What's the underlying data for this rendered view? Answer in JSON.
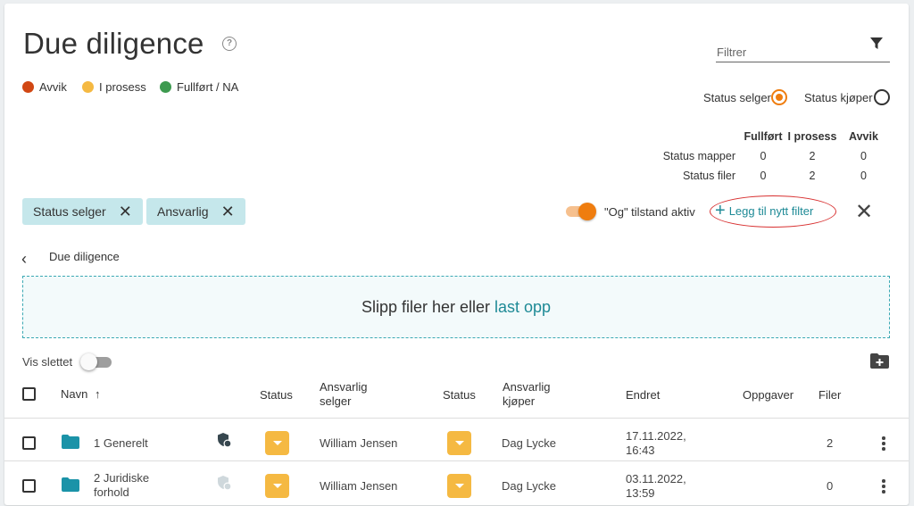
{
  "header": {
    "title": "Due diligence",
    "help_icon": "help-circle-icon",
    "filter_placeholder": "Filtrer"
  },
  "legend": [
    {
      "label": "Avvik",
      "color": "#d14713"
    },
    {
      "label": "I prosess",
      "color": "#f5b942"
    },
    {
      "label": "Fullført / NA",
      "color": "#3d9a4f"
    }
  ],
  "status_toggle": {
    "seller_label": "Status selger",
    "buyer_label": "Status kjøper",
    "selected": "Status selger"
  },
  "stats": {
    "columns": [
      "Fullført",
      "I prosess",
      "Avvik"
    ],
    "rows": [
      {
        "label": "Status mapper",
        "values": [
          "0",
          "2",
          "0"
        ]
      },
      {
        "label": "Status filer",
        "values": [
          "0",
          "2",
          "0"
        ]
      }
    ]
  },
  "filters": {
    "chips": [
      "Status selger",
      "Ansvarlig"
    ],
    "and_mode_label": "\"Og\" tilstand aktiv",
    "and_mode_on": true,
    "add_filter_label": "Legg til nytt filter"
  },
  "breadcrumb": {
    "current": "Due diligence"
  },
  "dropzone": {
    "text": "Slipp filer her eller",
    "link": "last opp"
  },
  "show_deleted": {
    "label": "Vis slettet",
    "on": false
  },
  "table": {
    "headers": {
      "name": "Navn",
      "status_seller": "Status",
      "responsible_seller_1": "Ansvarlig",
      "responsible_seller_2": "selger",
      "status_buyer": "Status",
      "responsible_buyer_1": "Ansvarlig",
      "responsible_buyer_2": "kjøper",
      "changed": "Endret",
      "tasks": "Oppgaver",
      "files": "Filer"
    },
    "rows": [
      {
        "name_1": "1 Generelt",
        "name_2": "",
        "responsible_seller": "William Jensen",
        "responsible_buyer": "Dag Lycke",
        "changed_date": "17.11.2022,",
        "changed_time": "16:43",
        "tasks": "",
        "files": "2"
      },
      {
        "name_1": "2 Juridiske",
        "name_2": "forhold",
        "responsible_seller": "William Jensen",
        "responsible_buyer": "Dag Lycke",
        "changed_date": "03.11.2022,",
        "changed_time": "13:59",
        "tasks": "",
        "files": "0"
      }
    ]
  }
}
